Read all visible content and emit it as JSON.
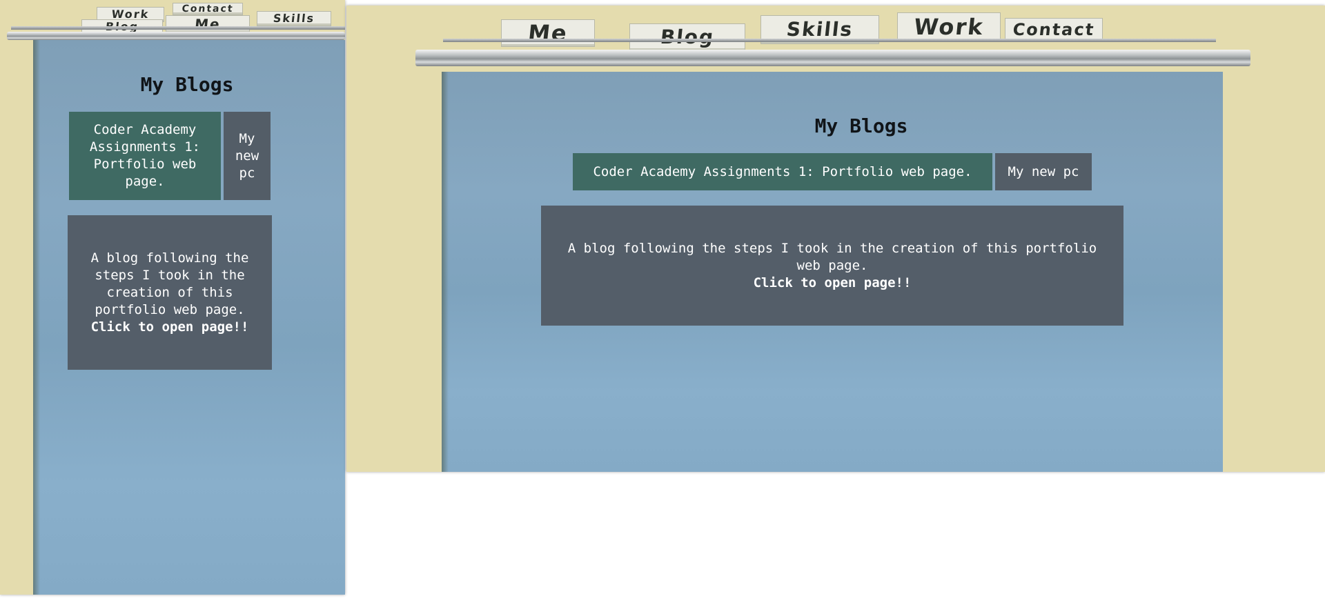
{
  "folder_tabs": {
    "me": "Me",
    "blog": "Blog",
    "skills": "Skills",
    "work": "Work",
    "contact": "Contact"
  },
  "blogs": {
    "title": "My Blogs",
    "tabs": [
      {
        "label": "Coder Academy Assignments 1: Portfolio web page.",
        "active": true
      },
      {
        "label": "My new pc",
        "active": false
      }
    ],
    "panel": {
      "description": "A blog following the steps I took in the creation of this portfolio web page.",
      "cta": "Click to open page!!"
    }
  },
  "colors": {
    "active_tab": "#3f6a63",
    "inactive_tab": "#535d67",
    "panel": "#545e69",
    "paper": "#84a6c0",
    "background": "#e4dcae"
  }
}
